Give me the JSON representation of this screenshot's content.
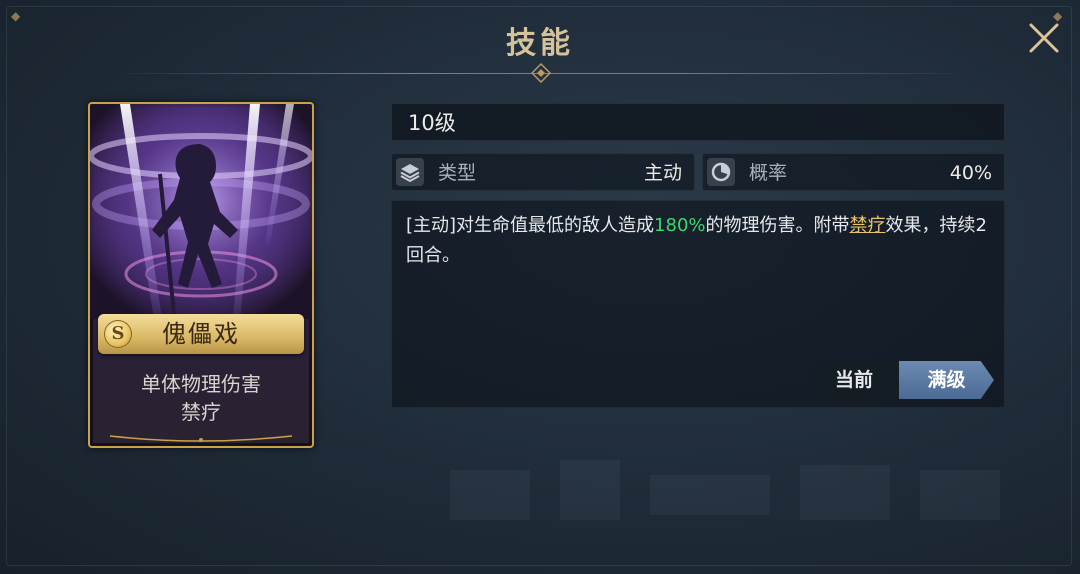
{
  "window": {
    "title": "技能"
  },
  "card": {
    "rank": "S",
    "name": "傀儡戏",
    "tags": [
      "单体物理伤害",
      "禁疗"
    ]
  },
  "skill": {
    "level": "10级",
    "type_label": "类型",
    "type_value": "主动",
    "rate_label": "概率",
    "rate_value": "40%",
    "description": {
      "part1": "[主动]对生命值最低的敌人造成",
      "highlight_pct": "180%",
      "part2": "的物理伤害。附带",
      "link": "禁疗",
      "part3": "效果，持续2回合。"
    }
  },
  "toggle": {
    "current_label": "当前",
    "max_label": "满级"
  },
  "icons": {
    "close": "close-icon",
    "type": "layers-icon",
    "rate": "pie-chart-icon"
  },
  "colors": {
    "title_gold": "#d4c29a",
    "highlight_green": "#3bd86b",
    "link_gold": "#e9c56a",
    "card_border": "#c9a24c",
    "toggle_active": "#5a79a3"
  }
}
